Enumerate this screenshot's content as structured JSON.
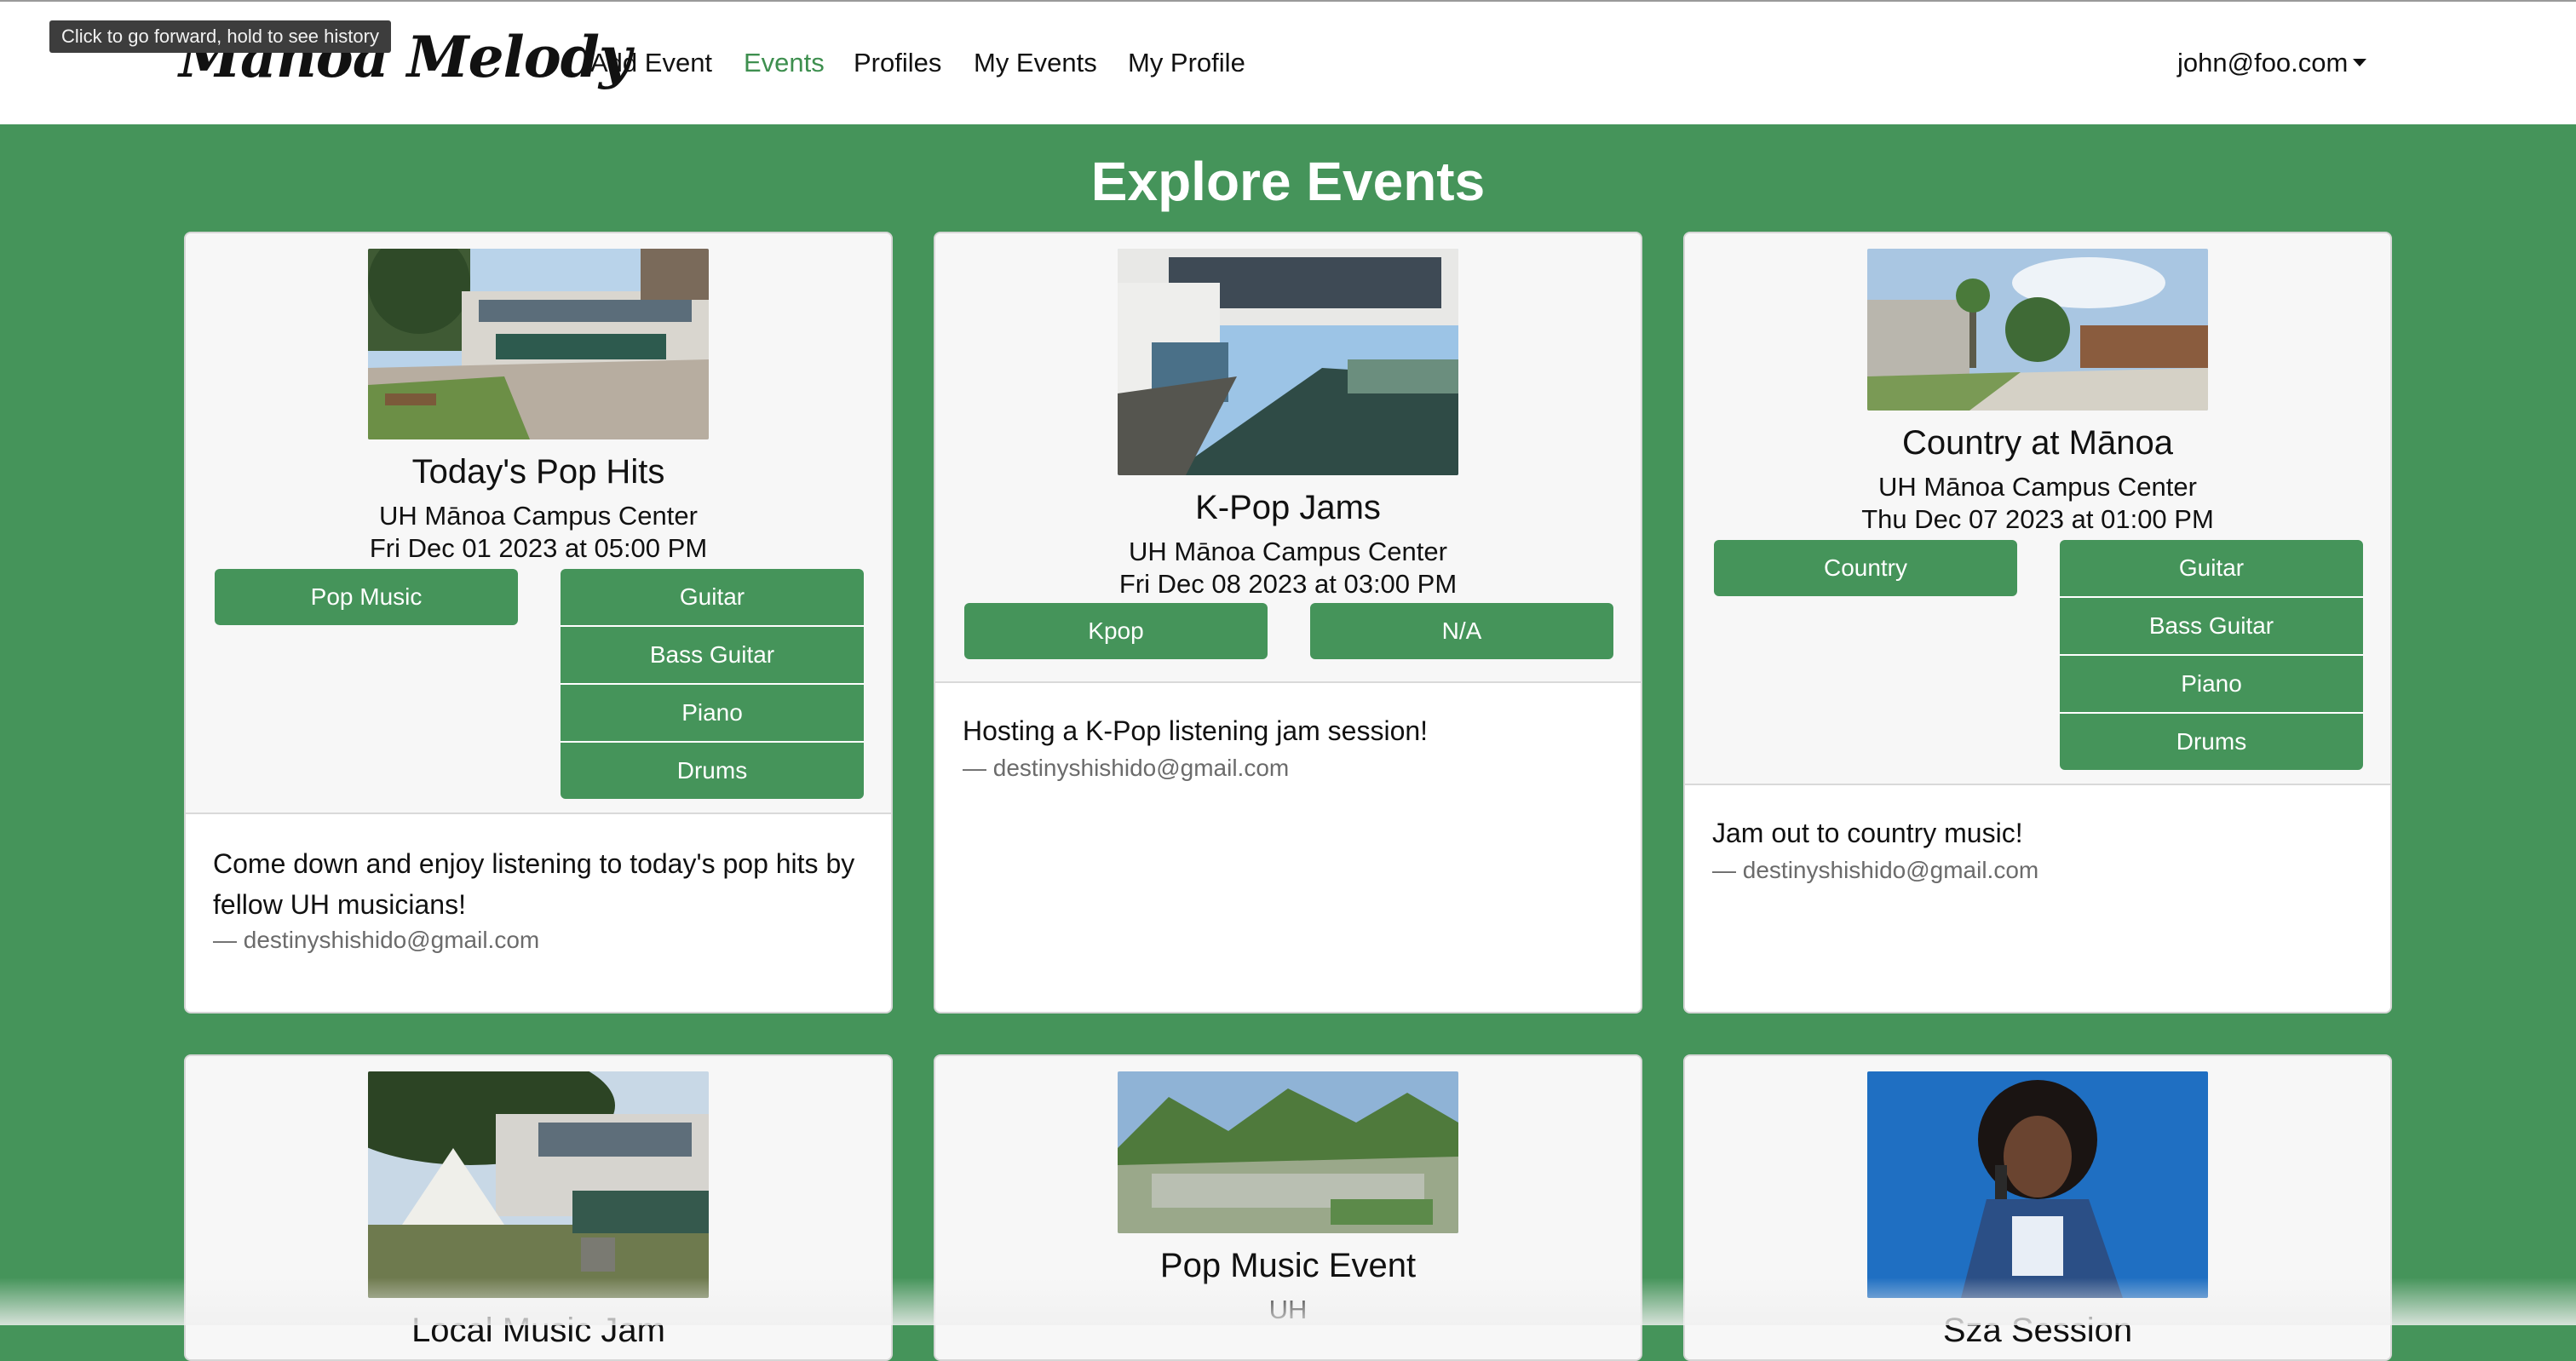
{
  "window": {
    "tooltip": "Click to go forward, hold to see history"
  },
  "nav": {
    "brand": "Mānoa Melody",
    "links": [
      "Add Event",
      "Events",
      "Profiles",
      "My Events",
      "My Profile"
    ],
    "active": "Events",
    "user": "john@foo.com"
  },
  "page": {
    "title": "Explore Events"
  },
  "colors": {
    "accent": "#45945a",
    "card_header": "#f7f7f7",
    "active_link": "#3e8f4f"
  },
  "events": [
    {
      "title": "Today's Pop Hits",
      "location": "UH Mānoa Campus Center",
      "date": "Fri Dec 01 2023 at 05:00 PM",
      "genre": "Pop Music",
      "instruments": [
        "Guitar",
        "Bass Guitar",
        "Piano",
        "Drums"
      ],
      "description": "Come down and enjoy listening to today's pop hits by fellow UH musicians!",
      "owner": "— destinyshishido@gmail.com"
    },
    {
      "title": "K-Pop Jams",
      "location": "UH Mānoa Campus Center",
      "date": "Fri Dec 08 2023 at 03:00 PM",
      "genre": "Kpop",
      "instruments": [
        "N/A"
      ],
      "description": "Hosting a K-Pop listening jam session!",
      "owner": "— destinyshishido@gmail.com"
    },
    {
      "title": "Country at Mānoa",
      "location": "UH Mānoa Campus Center",
      "date": "Thu Dec 07 2023 at 01:00 PM",
      "genre": "Country",
      "instruments": [
        "Guitar",
        "Bass Guitar",
        "Piano",
        "Drums"
      ],
      "description": "Jam out to country music!",
      "owner": "— destinyshishido@gmail.com"
    },
    {
      "title": "Local Music Jam"
    },
    {
      "title": "Pop Music Event",
      "location": "UH"
    },
    {
      "title": "Sza Session"
    }
  ]
}
